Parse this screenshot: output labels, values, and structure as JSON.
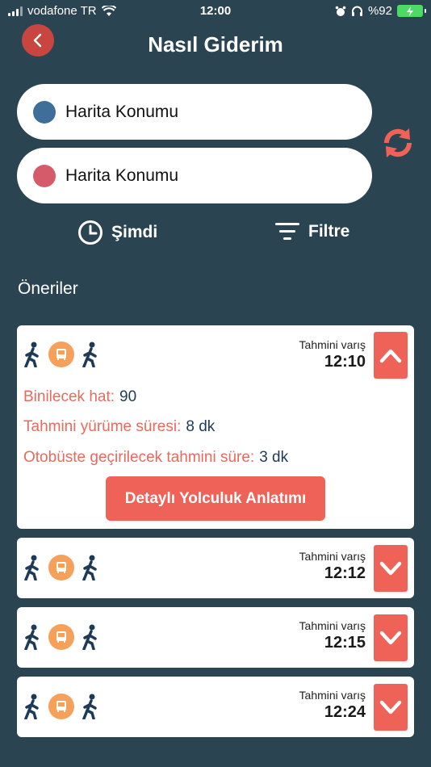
{
  "status_bar": {
    "carrier": "vodafone TR",
    "time": "12:00",
    "battery": "%92"
  },
  "header": {
    "title": "Nasıl Giderim"
  },
  "origin": {
    "text": "Harita Konumu",
    "dot_color": "#3f6f99"
  },
  "destination": {
    "text": "Harita Konumu",
    "dot_color": "#d55b6b"
  },
  "options": {
    "time_label": "Şimdi",
    "filter_label": "Filtre"
  },
  "suggestions_title": "Öneriler",
  "routes": [
    {
      "arrival_label": "Tahmini varış",
      "arrival_time": "12:10",
      "expanded": true,
      "line_label": "Binilecek hat:",
      "line_value": "90",
      "walk_label": "Tahmini yürüme süresi:",
      "walk_value": "8 dk",
      "bus_label": "Otobüste geçirilecek tahmini süre:",
      "bus_value": "3 dk",
      "detail_button": "Detaylı Yolculuk Anlatımı"
    },
    {
      "arrival_label": "Tahmini varış",
      "arrival_time": "12:12",
      "expanded": false
    },
    {
      "arrival_label": "Tahmini varış",
      "arrival_time": "12:15",
      "expanded": false
    },
    {
      "arrival_label": "Tahmini varış",
      "arrival_time": "12:24",
      "expanded": false
    }
  ],
  "colors": {
    "background": "#2a4451",
    "accent": "#ee6258",
    "bus": "#f5a15c",
    "walk_icon": "#1d3b57"
  }
}
